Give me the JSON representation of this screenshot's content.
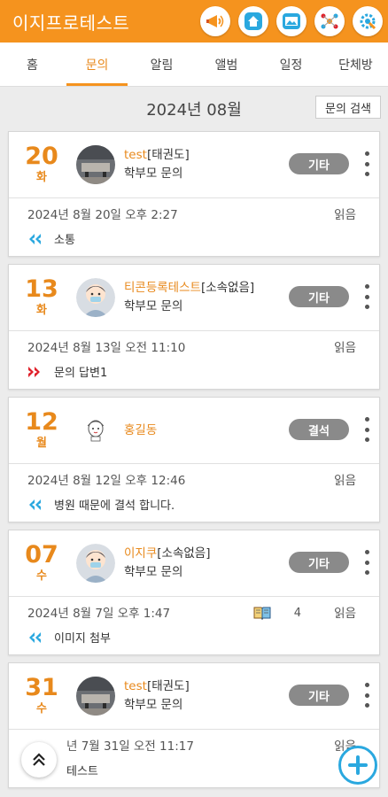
{
  "header": {
    "title": "이지프로테스트",
    "icons": [
      "megaphone-icon",
      "home-icon",
      "photo-icon",
      "share-icon",
      "settings-icon"
    ]
  },
  "tabs": [
    {
      "label": "홈"
    },
    {
      "label": "문의",
      "active": true
    },
    {
      "label": "알림"
    },
    {
      "label": "앨범"
    },
    {
      "label": "일정"
    },
    {
      "label": "단체방"
    }
  ],
  "month_bar": {
    "month": "2024년 08월",
    "search_label": "문의 검색"
  },
  "inquiries": [
    {
      "day": "20",
      "dow": "화",
      "name": "test",
      "org": "[태권도]",
      "role": "학부모 문의",
      "badge": "기타",
      "timestamp": "2024년 8월 20일 오후 2:27",
      "read": "읽음",
      "subject": "소통",
      "direction": "in",
      "avatar": "photo"
    },
    {
      "day": "13",
      "dow": "화",
      "name": "티콘등록테스트",
      "org": "[소속없음]",
      "role": "학부모 문의",
      "badge": "기타",
      "timestamp": "2024년 8월 13일 오전 11:10",
      "read": "읽음",
      "subject": "문의 답변1",
      "direction": "out",
      "avatar": "person"
    },
    {
      "day": "12",
      "dow": "월",
      "name": "홍길동",
      "org": "",
      "role": "",
      "badge": "결석",
      "timestamp": "2024년 8월 12일 오후 12:46",
      "read": "읽음",
      "subject": "병원 때문에 결석 합니다.",
      "direction": "in",
      "avatar": "cartoon"
    },
    {
      "day": "07",
      "dow": "수",
      "name": "이지쿠",
      "org": "[소속없음]",
      "role": "학부모 문의",
      "badge": "기타",
      "timestamp": "2024년 8월 7일 오후 1:47",
      "read": "읽음",
      "subject": "이미지 첨부",
      "direction": "in",
      "avatar": "person",
      "attachment_count": "4"
    },
    {
      "day": "31",
      "dow": "수",
      "name": "test",
      "org": "[태권도]",
      "role": "학부모 문의",
      "badge": "기타",
      "timestamp": "년 7월 31일 오전 11:17",
      "read": "읽음",
      "subject": "테스트",
      "direction": "in",
      "avatar": "photo"
    }
  ],
  "colors": {
    "brand": "#f5931e",
    "accent_date": "#e8891c",
    "fab_blue": "#2aa8df",
    "incoming_arrow": "#2aa8df",
    "outgoing_arrow": "#e0202a",
    "badge_gray": "#8a8a8a"
  }
}
